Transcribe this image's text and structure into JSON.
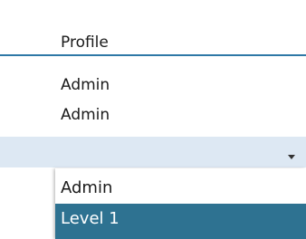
{
  "column": {
    "header": "Profile"
  },
  "rows": [
    {
      "profile": "Admin"
    },
    {
      "profile": "Admin"
    }
  ],
  "edit_row": {
    "value": "",
    "icon": "chevron-down-icon"
  },
  "dropdown": {
    "options": [
      "Admin",
      "Level 1"
    ],
    "highlighted": "Level 1"
  },
  "colors": {
    "header_border": "#2e78a6",
    "edit_row_bg": "#dde8f3",
    "highlight_bg": "#2e7291",
    "highlight_text": "#ffffff"
  }
}
